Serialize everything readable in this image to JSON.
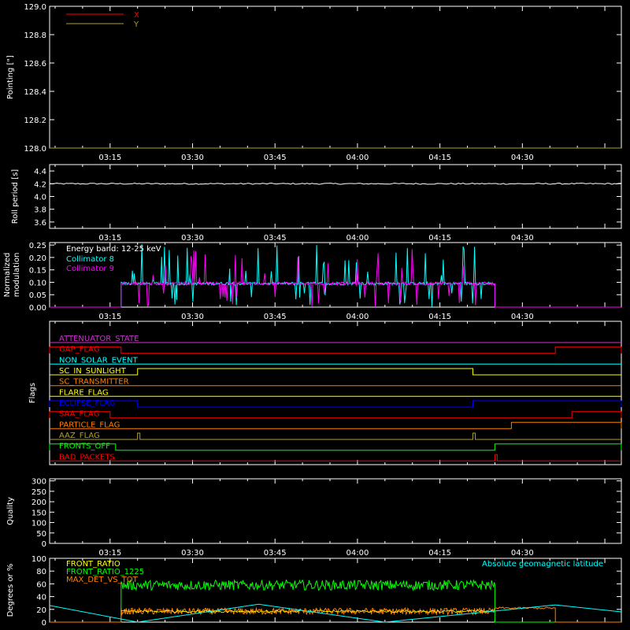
{
  "colors": {
    "background": "#000000",
    "axes": "#ffffff",
    "red": "#ff0000",
    "olive": "#b0a020",
    "white": "#ffffff",
    "cyan": "#00ffff",
    "magenta": "#ff00ff",
    "yellow": "#ffff00",
    "orange": "#ff8000",
    "blue": "#0000ff",
    "green": "#00ff00",
    "purple": "#cc33cc"
  },
  "time_axis": {
    "start": "03:04",
    "end": "04:48",
    "tick_labels": [
      "03:15",
      "03:30",
      "03:45",
      "04:00",
      "04:15",
      "04:30"
    ]
  },
  "chart_data": [
    {
      "type": "line",
      "name": "pointing",
      "ylabel": "Pointing [\"]",
      "ylim": [
        128.0,
        129.0
      ],
      "y_ticks": [
        "128.0",
        "128.2",
        "128.4",
        "128.6",
        "128.8",
        "129.0"
      ],
      "legend": [
        {
          "label": "X",
          "color": "#ff0000"
        },
        {
          "label": "Y",
          "color": "#b0a020"
        }
      ],
      "series": [
        {
          "name": "X",
          "x": [
            "03:04",
            "04:48"
          ],
          "values": [
            128.0,
            128.0
          ],
          "color": "#ff0000"
        },
        {
          "name": "Y",
          "x": [
            "03:04",
            "04:48"
          ],
          "values": [
            128.0,
            128.0
          ],
          "color": "#b0a020"
        }
      ]
    },
    {
      "type": "line",
      "name": "roll_period",
      "ylabel": "Roll period [s]",
      "ylim": [
        3.5,
        4.5
      ],
      "y_ticks": [
        "3.6",
        "3.8",
        "4.0",
        "4.2",
        "4.4"
      ],
      "series": [
        {
          "name": "roll",
          "x": [
            "03:04",
            "04:48"
          ],
          "values": [
            4.2,
            4.2
          ],
          "color": "#ffffff"
        }
      ]
    },
    {
      "type": "line",
      "name": "modulation",
      "ylabel": "Normalized modulation",
      "ylim": [
        0.0,
        0.26
      ],
      "y_ticks": [
        "0.00",
        "0.05",
        "0.10",
        "0.15",
        "0.20",
        "0.25"
      ],
      "annotation": "Energy band: 12-25 keV",
      "legend": [
        {
          "label": "Collimator 8",
          "color": "#00ffff"
        },
        {
          "label": "Collimator 9",
          "color": "#ff00ff"
        }
      ],
      "active_interval": [
        "03:17",
        "04:25"
      ],
      "baseline": 0.095,
      "series": [
        {
          "name": "Collimator 8",
          "color": "#00ffff"
        },
        {
          "name": "Collimator 9",
          "color": "#ff00ff"
        }
      ]
    },
    {
      "type": "flags",
      "name": "flags",
      "ylabel": "Flags",
      "rows": [
        {
          "label": "ATTENUATOR_STATE",
          "color": "#cc33cc",
          "on": []
        },
        {
          "label": "GAP_FLAG",
          "color": "#ff0000",
          "on": [
            [
              "03:04",
              "03:17"
            ],
            [
              "04:36",
              "04:48"
            ]
          ]
        },
        {
          "label": "NON_SOLAR_EVENT",
          "color": "#00ffff",
          "on": []
        },
        {
          "label": "SC_IN_SUNLIGHT",
          "color": "#ffff00",
          "on": [
            [
              "03:20",
              "04:21"
            ]
          ]
        },
        {
          "label": "SC_TRANSMITTER",
          "color": "#ff8000",
          "on": []
        },
        {
          "label": "FLARE_FLAG",
          "color": "#ffff00",
          "on": []
        },
        {
          "label": "ECLIPSE_FLAG",
          "color": "#0000ff",
          "on": [
            [
              "03:04",
              "03:20"
            ],
            [
              "04:21",
              "04:48"
            ]
          ]
        },
        {
          "label": "SAA_FLAG",
          "color": "#ff0000",
          "on": [
            [
              "03:04",
              "03:15"
            ],
            [
              "04:39",
              "04:48"
            ]
          ]
        },
        {
          "label": "PARTICLE_FLAG",
          "color": "#ff8000",
          "on": [
            [
              "04:28",
              "04:48"
            ]
          ]
        },
        {
          "label": "AAZ_FLAG",
          "color": "#b0a020",
          "on": [
            [
              "03:20",
              "03:20"
            ],
            [
              "04:21",
              "04:21"
            ]
          ]
        },
        {
          "label": "FRONTS_OFF",
          "color": "#00ff00",
          "on": [
            [
              "03:04",
              "03:16"
            ],
            [
              "04:25",
              "04:48"
            ]
          ]
        },
        {
          "label": "BAD_PACKETS",
          "color": "#ff0000",
          "on": [
            [
              "04:25",
              "04:25"
            ]
          ]
        }
      ]
    },
    {
      "type": "line",
      "name": "quality",
      "ylabel": "Quality",
      "ylim": [
        0,
        310
      ],
      "y_ticks": [
        "0",
        "50",
        "100",
        "150",
        "200",
        "250",
        "300"
      ],
      "series": [
        {
          "name": "quality",
          "x": [
            "03:04",
            "04:48"
          ],
          "values": [
            0,
            0
          ],
          "color": "#ffffff"
        }
      ]
    },
    {
      "type": "line",
      "name": "ratios",
      "ylabel": "Degrees or %",
      "ylim": [
        0,
        100
      ],
      "y_ticks": [
        "0",
        "20",
        "40",
        "60",
        "80",
        "100"
      ],
      "legend": [
        {
          "label": "FRONT_RATIO",
          "color": "#ffff00"
        },
        {
          "label": "FRONT_RATIO_1225",
          "color": "#00ff00"
        },
        {
          "label": "MAX_DET_VS_TOT",
          "color": "#ff8000"
        }
      ],
      "annotation": "Absolute geomagnetic latitude",
      "annotation_color": "#00ffff",
      "active_interval": [
        "03:17",
        "04:25"
      ],
      "series": [
        {
          "name": "FRONT_RATIO_1225",
          "level": 58,
          "color": "#00ff00"
        },
        {
          "name": "MAX_DET_VS_TOT",
          "level": 17,
          "color": "#ff8000"
        },
        {
          "name": "FRONT_RATIO",
          "level": 17,
          "color": "#ffff00"
        },
        {
          "name": "Absolute geomagnetic latitude",
          "x": [
            "03:04",
            "03:20",
            "03:42",
            "04:05",
            "04:36",
            "04:48"
          ],
          "values": [
            26,
            0,
            28,
            0,
            27,
            16
          ],
          "color": "#00ffff"
        }
      ]
    }
  ]
}
